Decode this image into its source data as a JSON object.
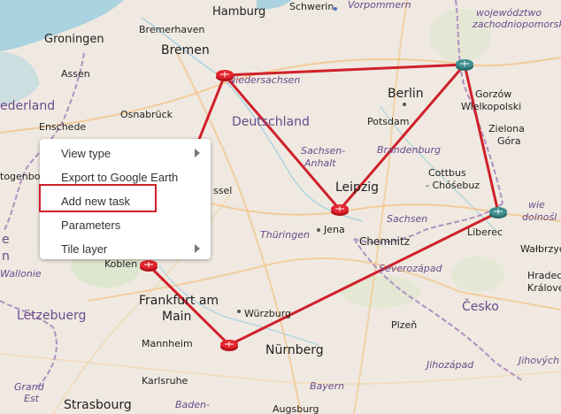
{
  "map": {
    "labels": {
      "hamburg": "Hamburg",
      "schwerin": "Schwerin",
      "vorpommern": "Vorpommern",
      "woj1": "województwo",
      "woj2": "zachodniopomorskie",
      "groningen": "Groningen",
      "bremerhaven": "Bremerhaven",
      "bremen": "Bremen",
      "assen": "Assen",
      "niedersachsen": "Niedersachsen",
      "nederland": "ederland",
      "enschede": "Enschede",
      "osnabruck": "Osnabrück",
      "deutschland": "Deutschland",
      "berlin": "Berlin",
      "potsdam": "Potsdam",
      "gorzow1": "Gorzów",
      "gorzow2": "Wielkopolski",
      "zielona1": "Zielona",
      "zielona2": "Góra",
      "togenbo": "togenbo",
      "ssel": "ssel",
      "sachsen_anhalt1": "Sachsen-",
      "sachsen_anhalt2": "Anhalt",
      "brandenburg": "Brandenburg",
      "cottbus1": "Cottbus",
      "cottbus2": "- Chóśebuz",
      "leipzig": "Leipzig",
      "sachsen": "Sachsen",
      "doln1": "wie",
      "doln2": "dolnośl",
      "thuringen": "Thüringen",
      "jena": "Jena",
      "chemnitz": "Chemnitz",
      "liberec": "Liberec",
      "walbrzych": "Wałbrzyc",
      "wallonie": "Wallonie",
      "koblenz": "Koblen",
      "severozapad": "Severozápad",
      "hradec1": "Hradec",
      "hradec2": "Králové",
      "letzebuerg": "Lëtzebuerg",
      "frankfurt1": "Frankfurt am",
      "frankfurt2": "Main",
      "wurzburg": "Würzburg",
      "cesko": "Česko",
      "mannheim": "Mannheim",
      "nurnberg": "Nürnberg",
      "plzen": "Plzeň",
      "jihozapad": "Jihozápad",
      "jihovych": "Jihových",
      "grandest1": "Grand",
      "grandest2": "Est",
      "karlsruhe": "Karlsruhe",
      "bayern": "Bayern",
      "strasbourg": "Strasbourg",
      "baden": "Baden-",
      "augsburg": "Augsburg",
      "edge_e": "e",
      "edge_n": "n"
    }
  },
  "link_color": "#d0202a",
  "context_menu": {
    "items": [
      {
        "label": "View type",
        "submenu": true
      },
      {
        "label": "Export to Google Earth",
        "submenu": false
      },
      {
        "label": "Add new task",
        "submenu": false
      },
      {
        "label": "Parameters",
        "submenu": false
      },
      {
        "label": "Tile layer",
        "submenu": true
      }
    ],
    "highlighted_item": "Add new task"
  }
}
